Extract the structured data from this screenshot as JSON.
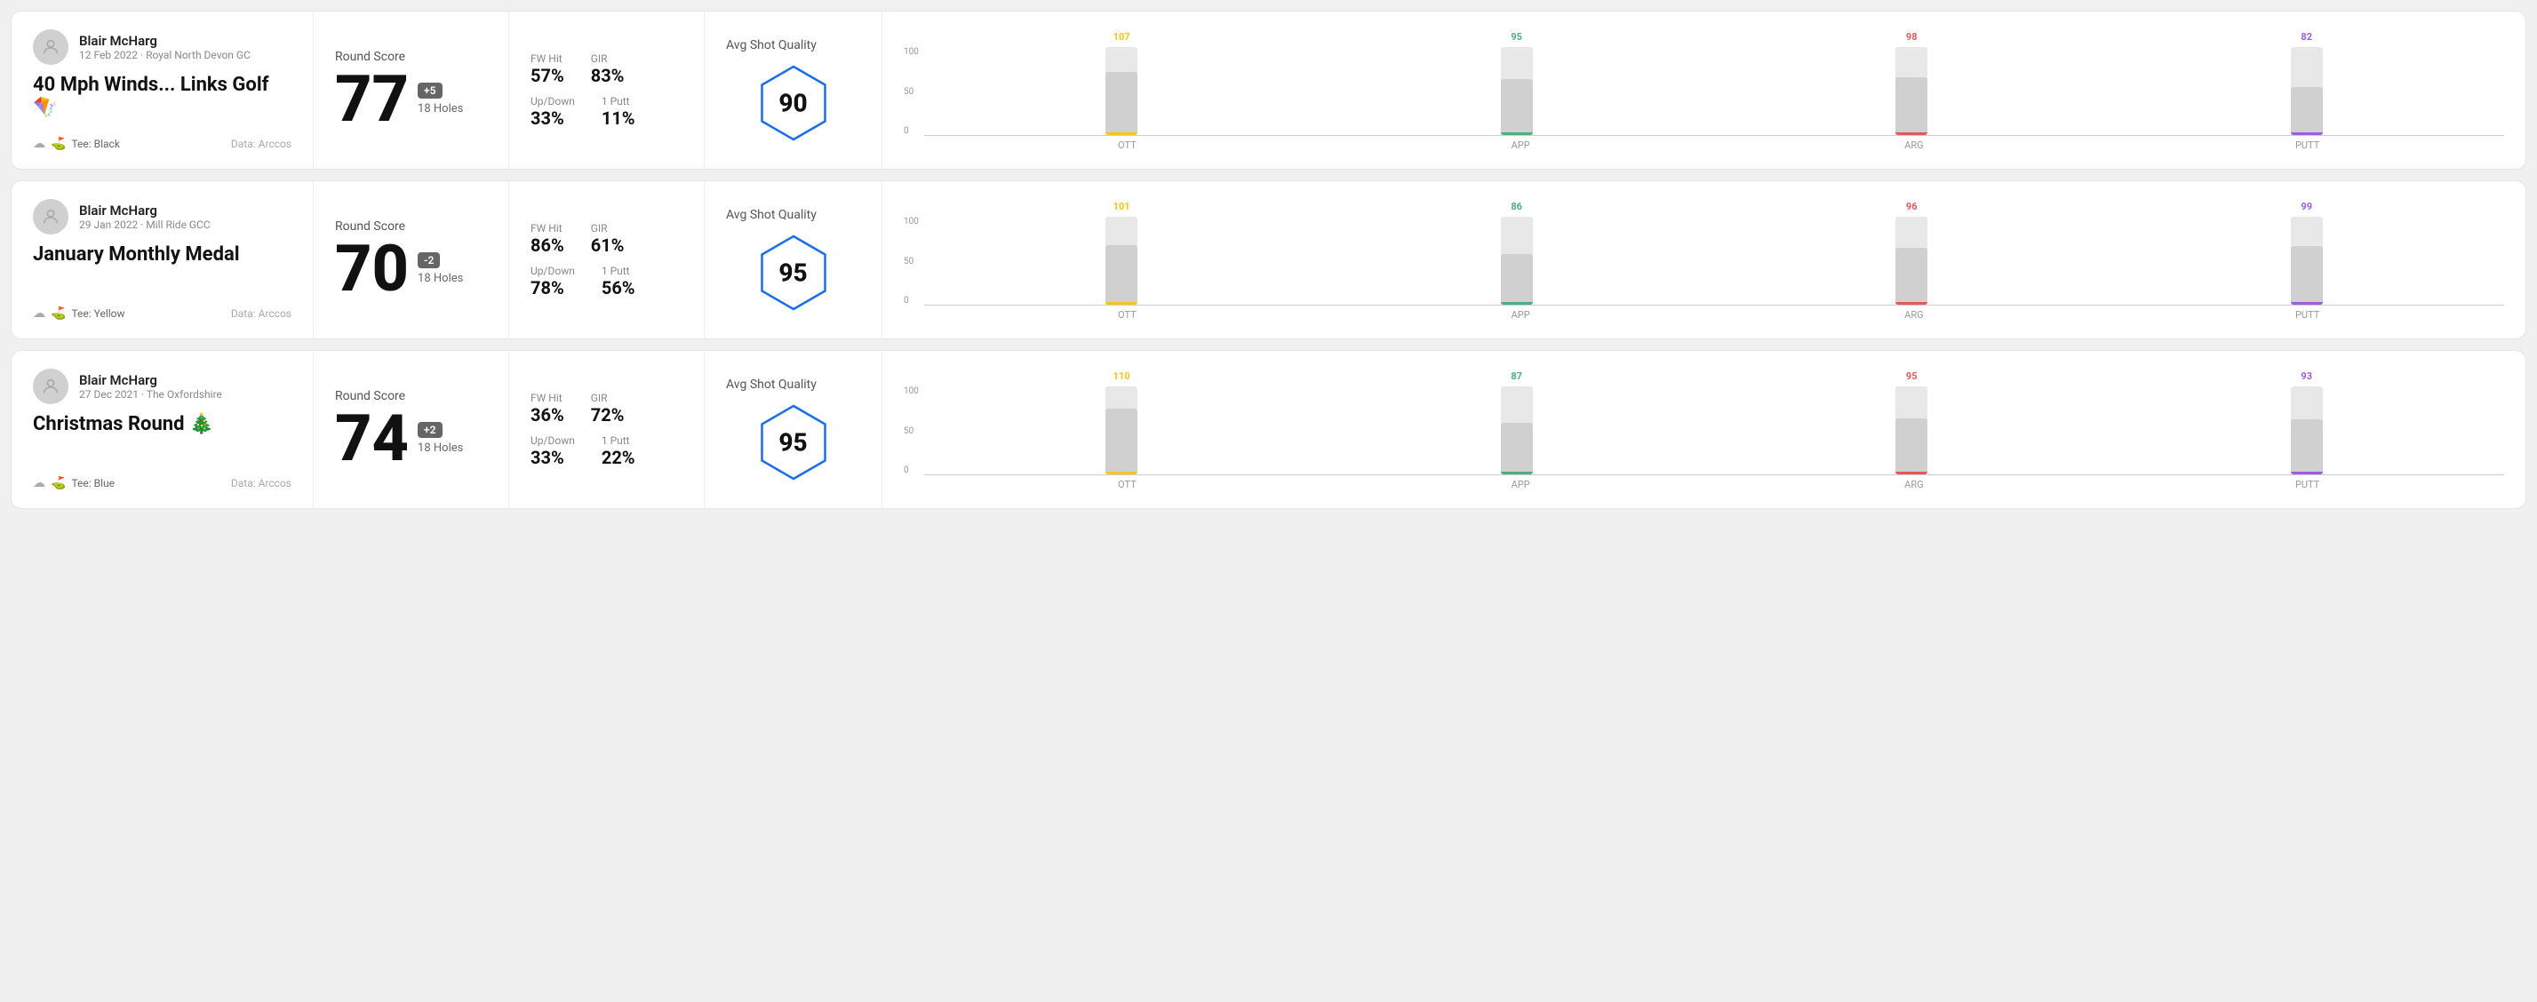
{
  "rounds": [
    {
      "id": "round-1",
      "user": {
        "name": "Blair McHarg",
        "meta": "12 Feb 2022 · Royal North Devon GC"
      },
      "title": "40 Mph Winds... Links Golf 🪁",
      "tee": "Black",
      "data_source": "Data: Arccos",
      "score": {
        "label": "Round Score",
        "value": "77",
        "diff": "+5",
        "diff_type": "positive",
        "holes": "18 Holes"
      },
      "stats": {
        "fw_hit_label": "FW Hit",
        "fw_hit_value": "57%",
        "gir_label": "GIR",
        "gir_value": "83%",
        "updown_label": "Up/Down",
        "updown_value": "33%",
        "oneputt_label": "1 Putt",
        "oneputt_value": "11%"
      },
      "quality": {
        "label": "Avg Shot Quality",
        "value": "90"
      },
      "chart": {
        "groups": [
          {
            "label": "OTT",
            "value": 107,
            "color": "#f5c518",
            "bar_pct": 72
          },
          {
            "label": "APP",
            "value": 95,
            "color": "#4caf7d",
            "bar_pct": 64
          },
          {
            "label": "ARG",
            "value": 98,
            "color": "#e05a5a",
            "bar_pct": 66
          },
          {
            "label": "PUTT",
            "value": 82,
            "color": "#9c5de0",
            "bar_pct": 55
          }
        ],
        "y_labels": [
          "100",
          "50",
          "0"
        ]
      }
    },
    {
      "id": "round-2",
      "user": {
        "name": "Blair McHarg",
        "meta": "29 Jan 2022 · Mill Ride GCC"
      },
      "title": "January Monthly Medal",
      "tee": "Yellow",
      "data_source": "Data: Arccos",
      "score": {
        "label": "Round Score",
        "value": "70",
        "diff": "-2",
        "diff_type": "negative",
        "holes": "18 Holes"
      },
      "stats": {
        "fw_hit_label": "FW Hit",
        "fw_hit_value": "86%",
        "gir_label": "GIR",
        "gir_value": "61%",
        "updown_label": "Up/Down",
        "updown_value": "78%",
        "oneputt_label": "1 Putt",
        "oneputt_value": "56%"
      },
      "quality": {
        "label": "Avg Shot Quality",
        "value": "95"
      },
      "chart": {
        "groups": [
          {
            "label": "OTT",
            "value": 101,
            "color": "#f5c518",
            "bar_pct": 68
          },
          {
            "label": "APP",
            "value": 86,
            "color": "#4caf7d",
            "bar_pct": 58
          },
          {
            "label": "ARG",
            "value": 96,
            "color": "#e05a5a",
            "bar_pct": 65
          },
          {
            "label": "PUTT",
            "value": 99,
            "color": "#9c5de0",
            "bar_pct": 67
          }
        ],
        "y_labels": [
          "100",
          "50",
          "0"
        ]
      }
    },
    {
      "id": "round-3",
      "user": {
        "name": "Blair McHarg",
        "meta": "27 Dec 2021 · The Oxfordshire"
      },
      "title": "Christmas Round 🎄",
      "tee": "Blue",
      "data_source": "Data: Arccos",
      "score": {
        "label": "Round Score",
        "value": "74",
        "diff": "+2",
        "diff_type": "positive",
        "holes": "18 Holes"
      },
      "stats": {
        "fw_hit_label": "FW Hit",
        "fw_hit_value": "36%",
        "gir_label": "GIR",
        "gir_value": "72%",
        "updown_label": "Up/Down",
        "updown_value": "33%",
        "oneputt_label": "1 Putt",
        "oneputt_value": "22%"
      },
      "quality": {
        "label": "Avg Shot Quality",
        "value": "95"
      },
      "chart": {
        "groups": [
          {
            "label": "OTT",
            "value": 110,
            "color": "#f5c518",
            "bar_pct": 75
          },
          {
            "label": "APP",
            "value": 87,
            "color": "#4caf7d",
            "bar_pct": 59
          },
          {
            "label": "ARG",
            "value": 95,
            "color": "#e05a5a",
            "bar_pct": 64
          },
          {
            "label": "PUTT",
            "value": 93,
            "color": "#9c5de0",
            "bar_pct": 63
          }
        ],
        "y_labels": [
          "100",
          "50",
          "0"
        ]
      }
    }
  ]
}
